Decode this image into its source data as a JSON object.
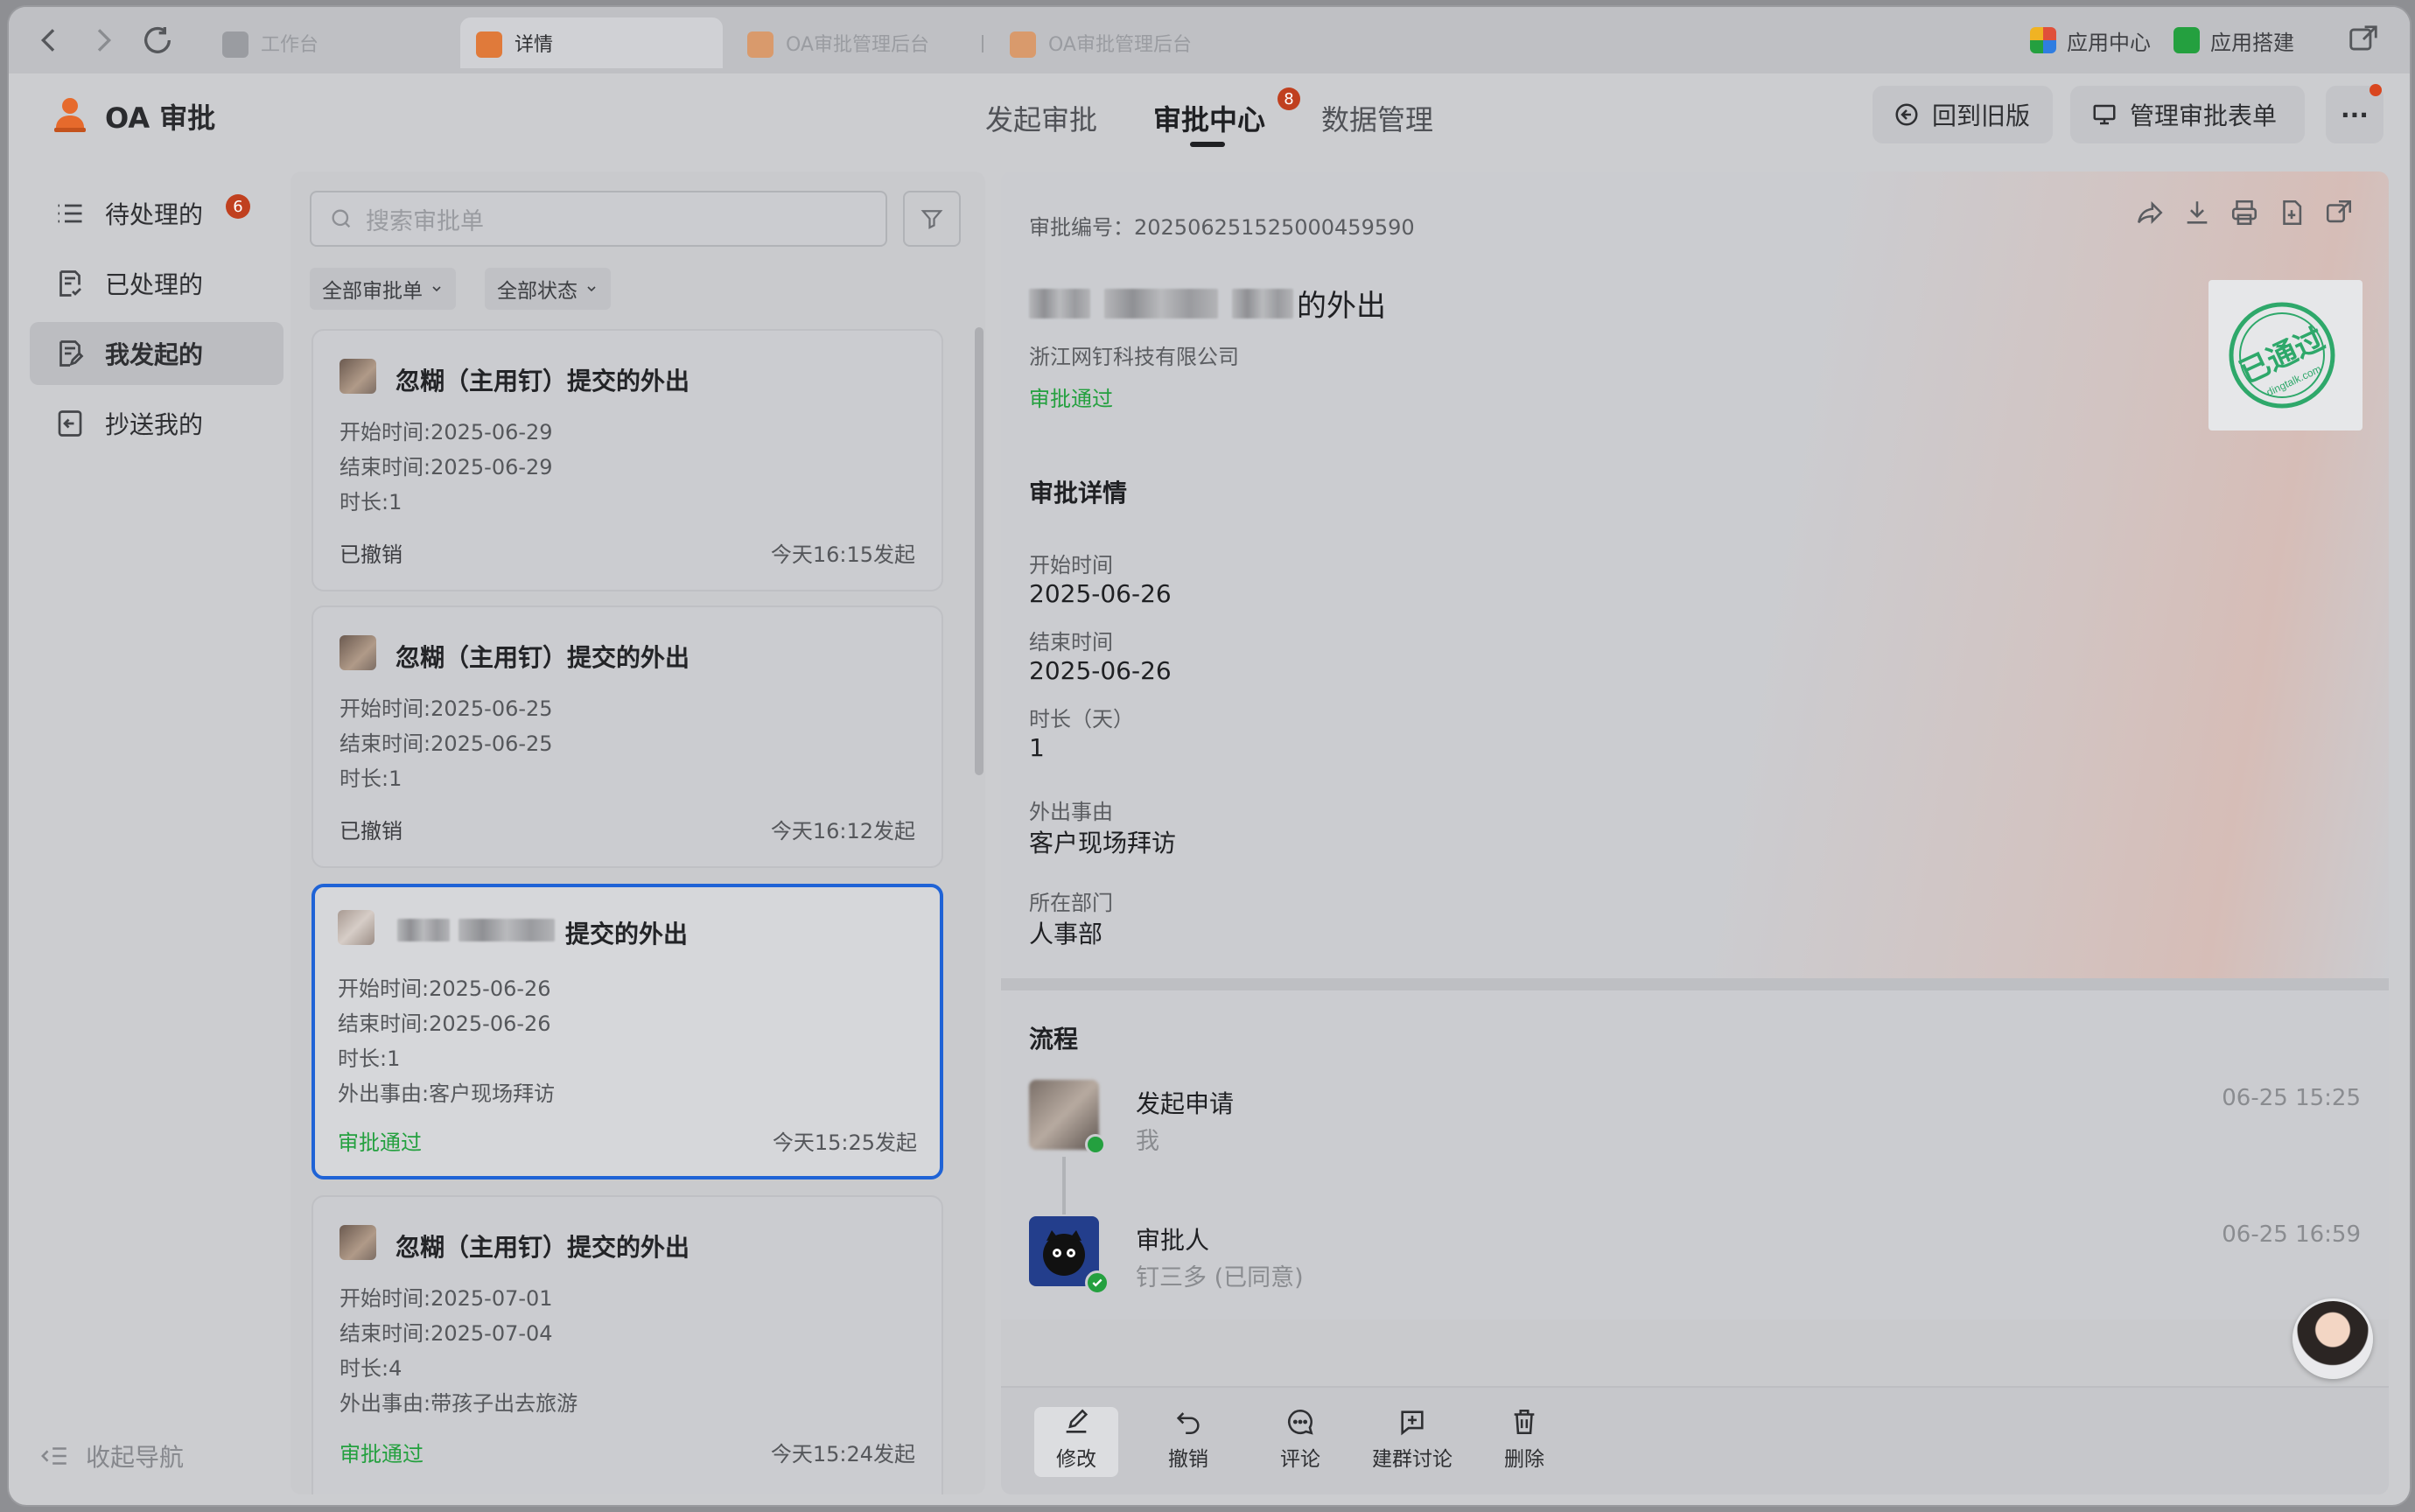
{
  "browser": {
    "tabs": [
      {
        "label": "工作台",
        "active": false
      },
      {
        "label": "详情",
        "active": true
      },
      {
        "label": "OA审批管理后台",
        "active": false
      },
      {
        "label": "OA审批管理后台",
        "active": false
      }
    ],
    "right_links": [
      "应用中心",
      "应用搭建"
    ]
  },
  "header": {
    "app_title": "OA 审批",
    "nav": [
      {
        "label": "发起审批",
        "active": false
      },
      {
        "label": "审批中心",
        "active": true,
        "badge": "8"
      },
      {
        "label": "数据管理",
        "active": false
      }
    ],
    "buttons": [
      "回到旧版",
      "管理审批表单"
    ],
    "more_label": "···"
  },
  "sidebar": {
    "items": [
      {
        "label": "待处理的",
        "badge": "6",
        "icon": "list-icon",
        "active": false
      },
      {
        "label": "已处理的",
        "icon": "processed-icon",
        "active": false
      },
      {
        "label": "我发起的",
        "icon": "initiated-icon",
        "active": true
      },
      {
        "label": "抄送我的",
        "icon": "cc-icon",
        "active": false
      }
    ],
    "collapse_label": "收起导航"
  },
  "list": {
    "search_placeholder": "搜索审批单",
    "filters": [
      "全部审批单",
      "全部状态"
    ],
    "cards": [
      {
        "title": "忽糊（主用钉）提交的外出",
        "lines": [
          "开始时间:2025-06-29",
          "结束时间:2025-06-29",
          "时长:1"
        ],
        "status": "已撤销",
        "time": "今天16:15发起",
        "selected": false
      },
      {
        "title": "忽糊（主用钉）提交的外出",
        "lines": [
          "开始时间:2025-06-25",
          "结束时间:2025-06-25",
          "时长:1"
        ],
        "status": "已撤销",
        "time": "今天16:12发起",
        "selected": false
      },
      {
        "title": "提交的外出",
        "lines": [
          "开始时间:2025-06-26",
          "结束时间:2025-06-26",
          "时长:1",
          "外出事由:客户现场拜访"
        ],
        "status": "审批通过",
        "time": "今天15:25发起",
        "selected": true
      },
      {
        "title": "忽糊（主用钉）提交的外出",
        "lines": [
          "开始时间:2025-07-01",
          "结束时间:2025-07-04",
          "时长:4",
          "外出事由:带孩子出去旅游"
        ],
        "status": "审批通过",
        "time": "今天15:24发起",
        "selected": false
      }
    ]
  },
  "detail": {
    "approval_no": "审批编号：202506251525000459590",
    "title_suffix": "的外出",
    "company": "浙江网钉科技有限公司",
    "status": "审批通过",
    "stamp_text": "已通过",
    "stamp_sub": "dingtalk.com",
    "section_title": "审批详情",
    "fields": [
      {
        "label": "开始时间",
        "value": "2025-06-26"
      },
      {
        "label": "结束时间",
        "value": "2025-06-26"
      },
      {
        "label": "时长（天）",
        "value": "1"
      },
      {
        "label": "外出事由",
        "value": "客户现场拜访"
      },
      {
        "label": "所在部门",
        "value": "人事部"
      }
    ],
    "flow_title": "流程",
    "flow": [
      {
        "title": "发起申请",
        "sub": "我",
        "time": "06-25 15:25"
      },
      {
        "title": "审批人",
        "sub": "钉三多 (已同意)",
        "time": "06-25 16:59"
      }
    ],
    "actions": [
      {
        "label": "修改",
        "icon": "edit-icon"
      },
      {
        "label": "撤销",
        "icon": "undo-icon"
      },
      {
        "label": "评论",
        "icon": "comment-icon"
      },
      {
        "label": "建群讨论",
        "icon": "group-discuss-icon"
      },
      {
        "label": "删除",
        "icon": "delete-icon"
      }
    ]
  },
  "colors": {
    "accent": "#1f63d6",
    "success": "#24a03f",
    "badge": "#c0401f"
  }
}
